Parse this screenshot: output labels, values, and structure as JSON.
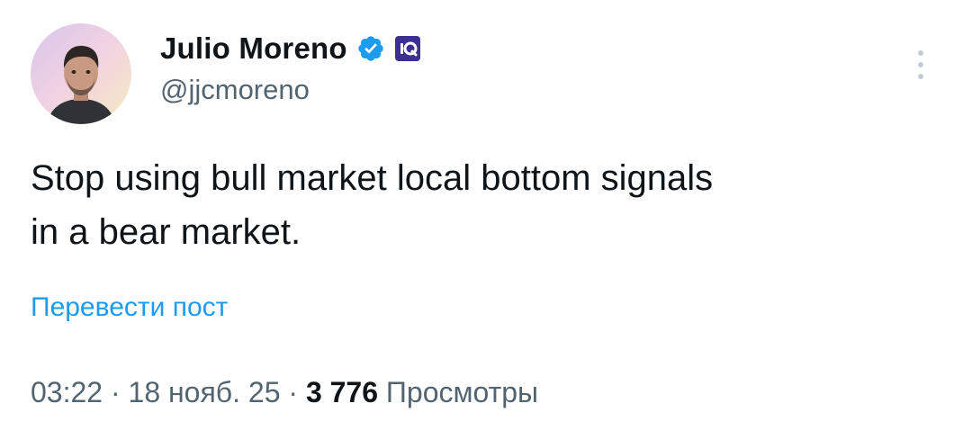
{
  "author": {
    "display_name": "Julio Moreno",
    "handle": "@jjcmoreno",
    "verified_icon": "verified-badge-icon",
    "affiliation_icon": "affiliate-logo-icon"
  },
  "tweet": {
    "text_line1": "Stop using bull market local bottom signals",
    "text_line2": "in a bear market."
  },
  "translate_label": "Перевести пост",
  "meta": {
    "time": "03:22",
    "sep1": " · ",
    "date": "18 нояб. 25",
    "sep2": " · ",
    "views_count": "3 776",
    "views_label": " Просмотры"
  },
  "colors": {
    "text": "#0f1419",
    "secondary": "#536471",
    "link": "#1d9bf0",
    "verified": "#1d9bf0",
    "affiliate_bg": "#3b2f8f"
  }
}
